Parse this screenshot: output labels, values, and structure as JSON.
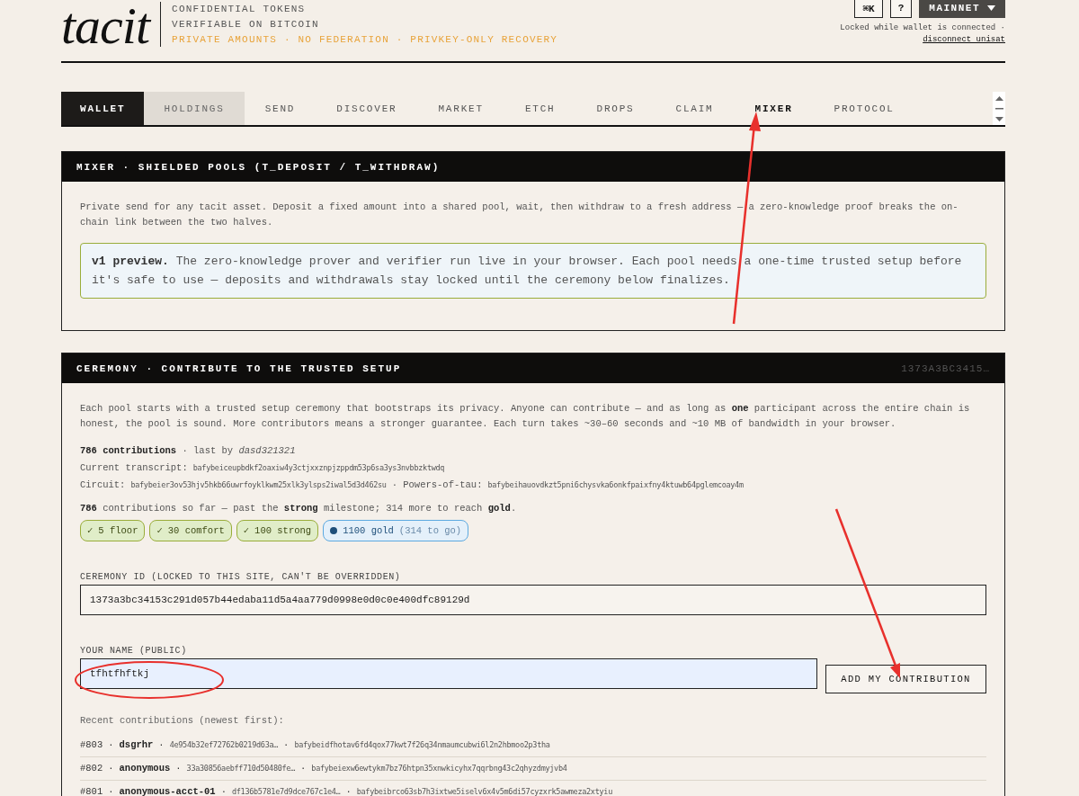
{
  "brand": {
    "logo": "tacit",
    "taglines": [
      "CONFIDENTIAL TOKENS",
      "VERIFIABLE ON BITCOIN"
    ],
    "highlight": "PRIVATE AMOUNTS · NO FEDERATION · PRIVKEY-ONLY RECOVERY"
  },
  "header_actions": {
    "buttons": [
      {
        "label": "⌘K",
        "kind": "outline"
      },
      {
        "label": "?",
        "kind": "outline"
      },
      {
        "label": "MAINNET",
        "kind": "dropdown"
      }
    ],
    "status": "Locked while wallet is connected ·",
    "link": "disconnect unisat"
  },
  "tabs": [
    {
      "label": "WALLET",
      "kind": "dark",
      "selected": false
    },
    {
      "label": "HOLDINGS",
      "kind": "muted",
      "selected": false
    },
    {
      "label": "SEND",
      "kind": "plain",
      "selected": false
    },
    {
      "label": "DISCOVER",
      "kind": "plain",
      "selected": false
    },
    {
      "label": "MARKET",
      "kind": "plain",
      "selected": false
    },
    {
      "label": "ETCH",
      "kind": "plain",
      "selected": false
    },
    {
      "label": "DROPS",
      "kind": "plain",
      "selected": false
    },
    {
      "label": "CLAIM",
      "kind": "plain",
      "selected": false
    },
    {
      "label": "MIXER",
      "kind": "plain",
      "selected": true
    },
    {
      "label": "PROTOCOL",
      "kind": "plain",
      "selected": false
    }
  ],
  "mixer": {
    "title": "MIXER · SHIELDED POOLS (T_DEPOSIT / T_WITHDRAW)",
    "intro": "Private send for any tacit asset. Deposit a fixed amount into a shared pool, wait, then withdraw to a fresh address — a zero-knowledge proof breaks the on-chain link between the two halves.",
    "notice": "**v1 preview.** The zero-knowledge prover and verifier run live in your browser. Each pool needs a one-time trusted setup before it's safe to use — deposits and withdrawals stay locked until the ceremony below finalizes."
  },
  "ceremony": {
    "title": "CEREMONY · CONTRIBUTE TO THE TRUSTED SETUP",
    "id_short": "1373A3BC3415…",
    "intro": "Each pool starts with a trusted setup ceremony that bootstraps its privacy. Anyone can contribute — and as long as **one** participant across the entire chain is honest, the pool is sound. More contributors means a stronger guarantee. Each turn takes ~30–60 seconds and ~10 MB of bandwidth in your browser.",
    "summary": "**786 contributions** · last by *dasd321321*",
    "transcript": {
      "label": "Current transcript:",
      "value": "bafybeiceupbdkf2oaxiw4y3ctjxxznpjzppdm53p6sa3ys3nvbbzktwdq"
    },
    "circuit": {
      "label": "Circuit:",
      "value": "bafybeier3ov53hjv5hkb66uwrfoyklkwm25xlk3ylsps2iwal5d3d462su"
    },
    "powers": {
      "label": "· Powers-of-tau:",
      "value": "bafybeihauovdkzt5pni6chysvka6onkfpaixfny4ktuwb64pglemcoay4m"
    },
    "progress": "**786** contributions so far — past the **strong** milestone; 314 more to reach **gold**.",
    "milestones": [
      {
        "check": "✓",
        "label": "5 floor",
        "done": true
      },
      {
        "check": "✓",
        "label": "30 comfort",
        "done": true
      },
      {
        "check": "✓",
        "label": "100 strong",
        "done": true
      },
      {
        "label": "1100 gold",
        "note": "(314 to go)",
        "done": false
      }
    ],
    "id_field": {
      "label": "CEREMONY ID (LOCKED TO THIS SITE, CAN'T BE OVERRIDDEN)",
      "value": "1373a3bc34153c291d057b44edaba11d5a4aa779d0998e0d0c0e400dfc89129d"
    },
    "name_field": {
      "label": "YOUR NAME (PUBLIC)",
      "value": "tfhtfhftkj"
    },
    "submit": "ADD MY CONTRIBUTION",
    "recent_label": "Recent contributions (newest first):",
    "recent": [
      {
        "num": "#803",
        "seps": [
          "·",
          "·",
          "·"
        ],
        "name": "dsgrhr",
        "hash": "4e954b32ef72762b0219d63a…",
        "cid": "bafybeidfhotav6fd4qox77kwt7f26q34nmaumcubwi6l2n2hbmoo2p3tha"
      },
      {
        "num": "#802",
        "seps": [
          "·",
          "·",
          "·"
        ],
        "name": "anonymous",
        "hash": "33a30856aebff710d50480fe…",
        "cid": "bafybeiexw6ewtykm7bz76htpn35xnwkicyhx7qqrbng43c2qhyzdmyjvb4"
      },
      {
        "num": "#801",
        "seps": [
          "·",
          "·",
          "·"
        ],
        "name": "anonymous-acct-01",
        "hash": "df136b5781e7d9dce767c1e4…",
        "cid": "bafybeibrco63sb7h3ixtwe5iselv6x4v5m6di57cyzxrk5awmeza2xtyiu"
      }
    ]
  }
}
